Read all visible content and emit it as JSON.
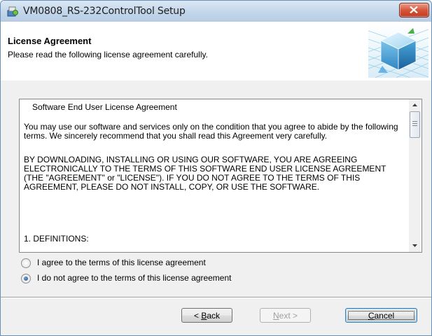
{
  "window": {
    "title": "VM0808_RS-232ControlTool Setup",
    "icons": {
      "app": "setup-installer-icon",
      "close": "close-icon"
    }
  },
  "header": {
    "title": "License Agreement",
    "subtitle": "Please read the following license agreement carefully.",
    "graphic": "installer-box-graphic"
  },
  "license": {
    "title": "Software End User License Agreement",
    "paragraphs": [
      "You may use our software and services only on the condition that you agree to abide by the following terms. We sincerely recommend that you shall read this Agreement very carefully.",
      "BY DOWNLOADING, INSTALLING OR USING OUR SOFTWARE, YOU ARE AGREEING ELECTRONICALLY TO THE TERMS OF THIS SOFTWARE END USER LICENSE AGREEMENT (THE \"AGREEMENT\" or \"LICENSE\"). IF YOU DO NOT AGREE TO THE TERMS OF THIS AGREEMENT, PLEASE DO NOT INSTALL, COPY, OR USE THE SOFTWARE.",
      "1. DEFINITIONS:"
    ]
  },
  "options": [
    {
      "label": "I agree to the terms of this license agreement",
      "checked": false
    },
    {
      "label": "I do not agree to the terms of this license agreement",
      "checked": true
    }
  ],
  "buttons": {
    "back": {
      "pre": "< ",
      "mnemonic": "B",
      "rest": "ack",
      "enabled": true
    },
    "next": {
      "mnemonic": "N",
      "rest": "ext >",
      "enabled": false
    },
    "cancel": {
      "mnemonic": "C",
      "rest": "ancel",
      "enabled": true,
      "focused": true
    }
  },
  "colors": {
    "close_button": "#c9462c",
    "title_bar": "#c3d6ea",
    "dialog_bg": "#f0f0f0"
  }
}
